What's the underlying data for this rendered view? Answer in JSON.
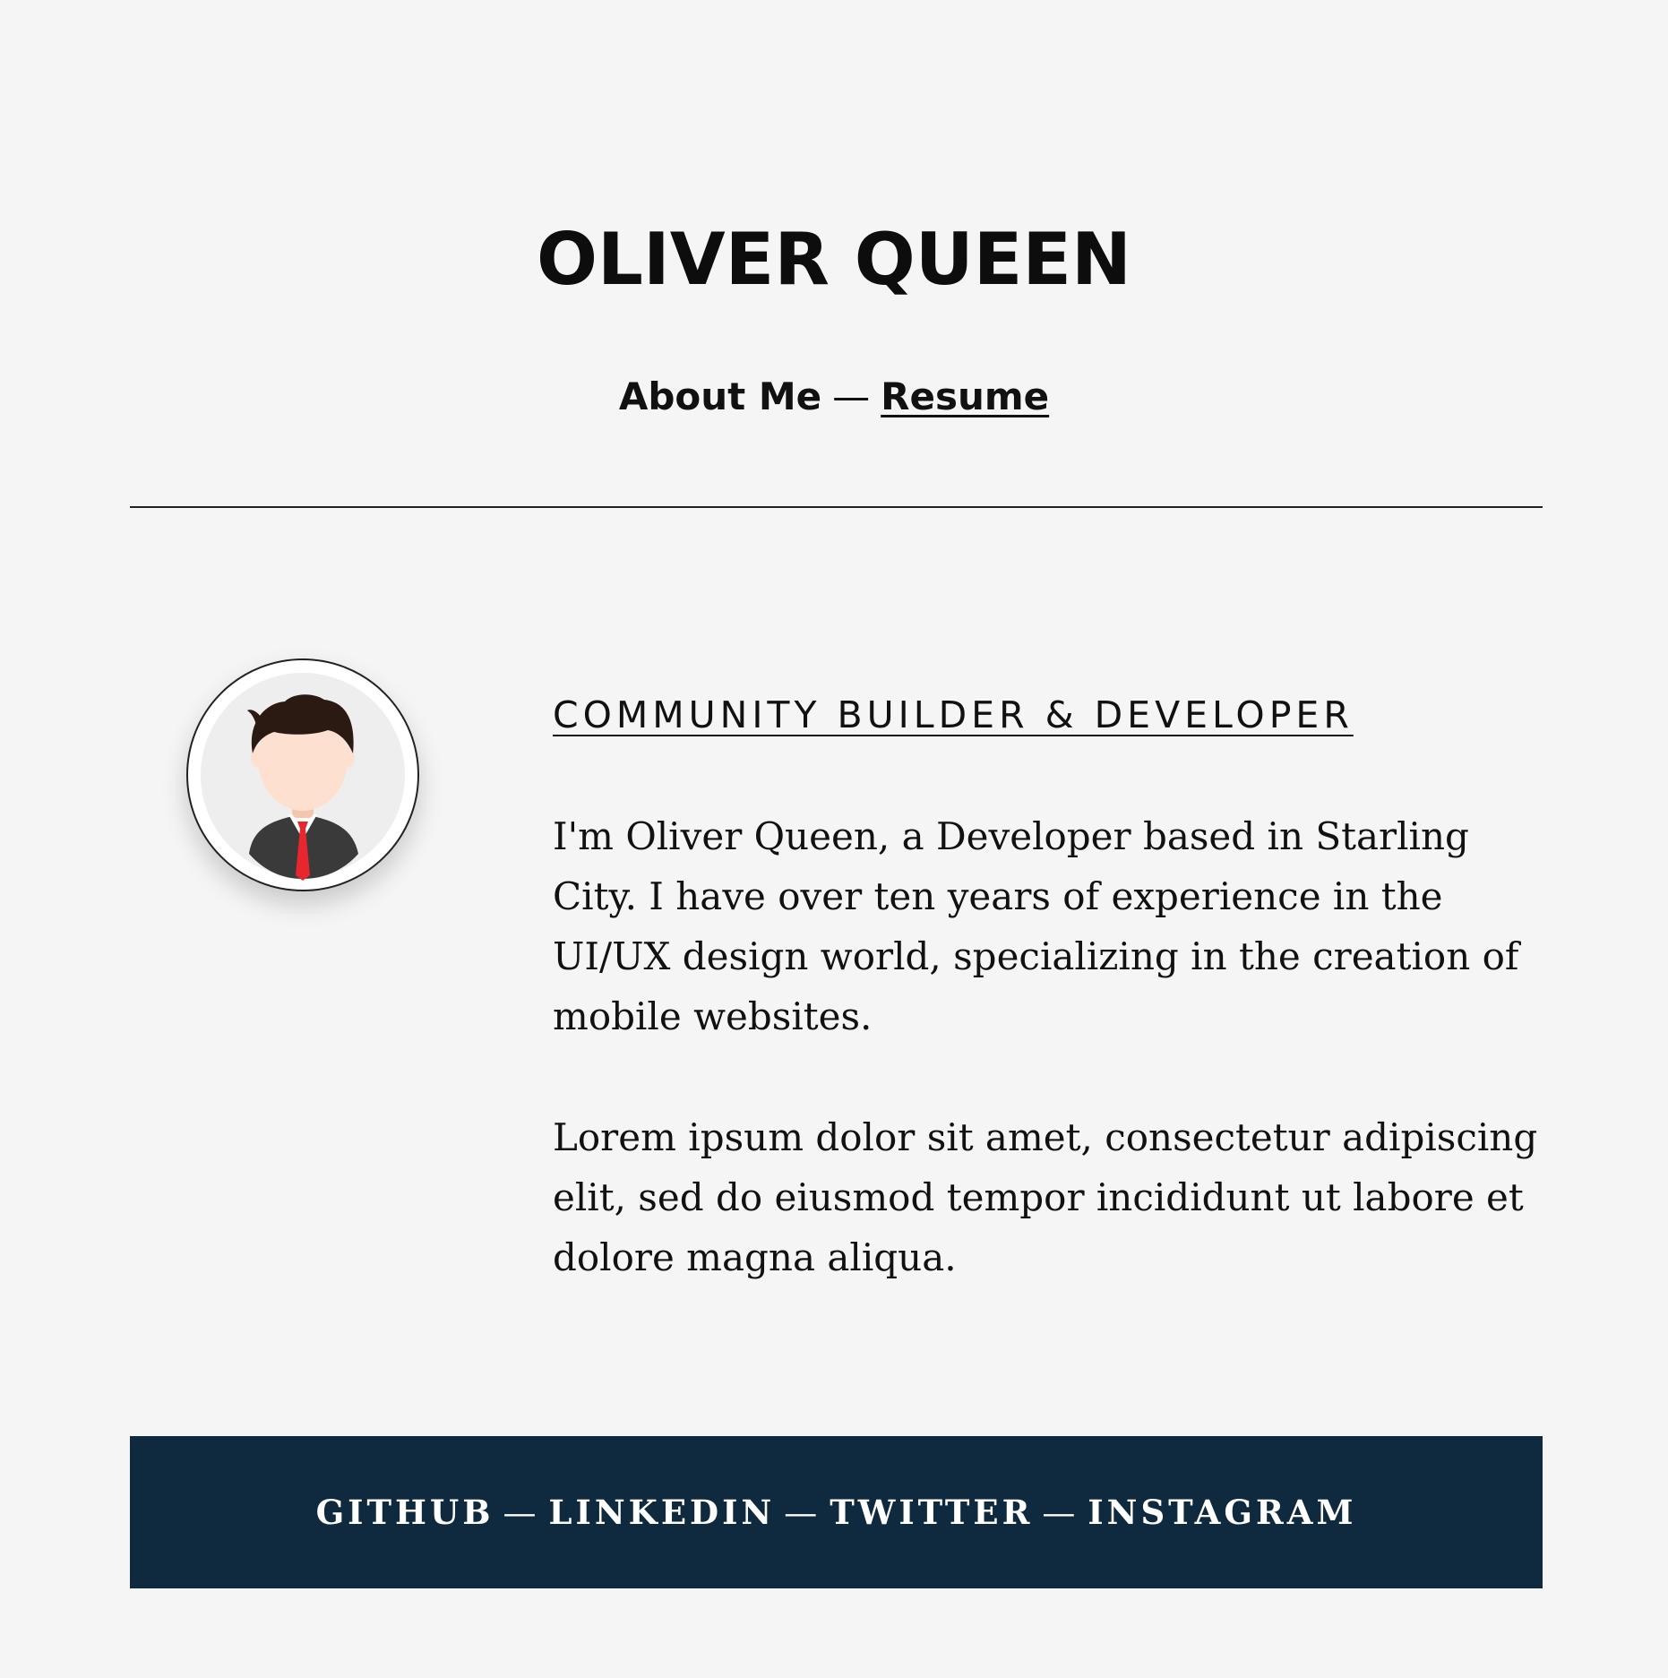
{
  "header": {
    "title": "OLIVER QUEEN",
    "nav": {
      "about_label": "About Me",
      "separator": "—",
      "resume_label": "Resume"
    }
  },
  "profile": {
    "avatar_icon": "person-avatar-icon",
    "tagline": "COMMUNITY BUILDER & DEVELOPER",
    "bio_paragraphs": [
      "I'm Oliver Queen, a Developer based in Starling City. I have over ten years of experience in the UI/UX design world, specializing in the creation of mobile websites.",
      "Lorem ipsum dolor sit amet, consectetur adipiscing elit, sed do eiusmod tempor incididunt ut labore et dolore magna aliqua."
    ]
  },
  "footer": {
    "separator": "—",
    "links": [
      {
        "label": "GITHUB"
      },
      {
        "label": "LINKEDIN"
      },
      {
        "label": "TWITTER"
      },
      {
        "label": "INSTAGRAM"
      }
    ]
  },
  "colors": {
    "background": "#f5f5f5",
    "text": "#111111",
    "footer_background": "#0f2a3e",
    "footer_text": "#ffffff",
    "tie": "#e8262e",
    "hair": "#2b1a12",
    "skin": "#fde0cf"
  }
}
